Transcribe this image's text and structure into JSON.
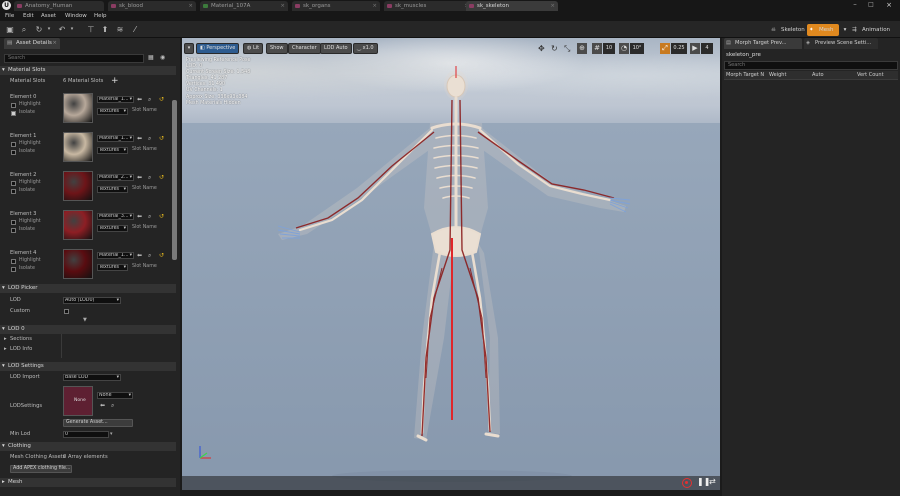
{
  "tabs": [
    {
      "label": "Anatomy_Human",
      "active": false
    },
    {
      "label": "sk_blood",
      "active": false
    },
    {
      "label": "Material_107A",
      "active": false
    },
    {
      "label": "sk_organs",
      "active": false
    },
    {
      "label": "sk_muscles",
      "active": false
    },
    {
      "label": "sk_skeleton",
      "active": true
    }
  ],
  "menu": [
    "File",
    "Edit",
    "Asset",
    "Window",
    "Help"
  ],
  "modes": {
    "skeleton": "Skeleton",
    "mesh": "Mesh",
    "animation": "Animation"
  },
  "left_panel": {
    "tab": "Asset Details",
    "search_placeholder": "Search",
    "material_slots_header": "Material Slots",
    "material_slots_label": "Material Slots",
    "material_slots_value": "6 Material Slots",
    "highlight_label": "Highlight",
    "isolate_label": "Isolate",
    "textures_label": "Textures",
    "slot_name_label": "Slot Name",
    "elements": [
      {
        "label": "Element 0",
        "material": "Material_1...",
        "color": "#b7a89a",
        "isolate": true
      },
      {
        "label": "Element 1",
        "material": "Material_1...",
        "color": "#c8b8a2",
        "isolate": false
      },
      {
        "label": "Element 2",
        "material": "Material_2...",
        "color": "#6e1418",
        "isolate": false
      },
      {
        "label": "Element 3",
        "material": "Material_3...",
        "color": "#8e1e24",
        "isolate": false
      },
      {
        "label": "Element 4",
        "material": "Material_1...",
        "color": "#5a0c10",
        "isolate": false
      }
    ],
    "lod_picker": {
      "header": "LOD Picker",
      "lod_label": "LOD",
      "lod_value": "Auto (LOD0)",
      "custom_label": "Custom"
    },
    "lod0": {
      "header": "LOD 0",
      "sections": "Sections",
      "lod_info": "LOD Info"
    },
    "lod_settings": {
      "header": "LOD Settings",
      "lod_import_label": "LOD Import",
      "lod_import_value": "Base LOD",
      "lod_settings_label": "LODSettings",
      "thumb_label": "None",
      "asset_value": "None",
      "generate_button": "Generate Asset...",
      "min_lod_label": "Min Lod",
      "min_lod_value": "0"
    },
    "clothing": {
      "header": "Clothing",
      "assets_label": "Mesh Clothing Assets",
      "assets_value": "0 Array elements",
      "add_button": "Add APEX clothing file..."
    },
    "mesh_header": "Mesh"
  },
  "viewport": {
    "perspective": "Perspective",
    "lit": "Lit",
    "show": "Show",
    "character": "Character",
    "lod_auto": "LOD Auto",
    "speed": "x1.0",
    "grid_snap": "10",
    "angle_snap": "10°",
    "scale_snap": "0.25",
    "camera_speed": "4",
    "overlay": [
      "Previewing Reference Pose",
      "LOD: 0",
      "Current Screen Size: 1.548",
      "Triangles: 41 287",
      "Vertices: 31 490",
      "UV Channels: 1",
      "Approx Size: 336x93x384",
      "Mesh Materials Hidden"
    ]
  },
  "right_panel": {
    "tab1": "Morph Target Prev...",
    "tab2": "Preview Scene Setti...",
    "asset_name": "skeleton_pre",
    "search_placeholder": "Search",
    "columns": [
      "Morph Target N",
      "Weight",
      "Auto",
      "Vert Count"
    ]
  },
  "colors": {
    "accent": "#e0891f",
    "selected_tab": "#3b3b3b",
    "panel": "#242424",
    "background": "#1b1b1b"
  }
}
